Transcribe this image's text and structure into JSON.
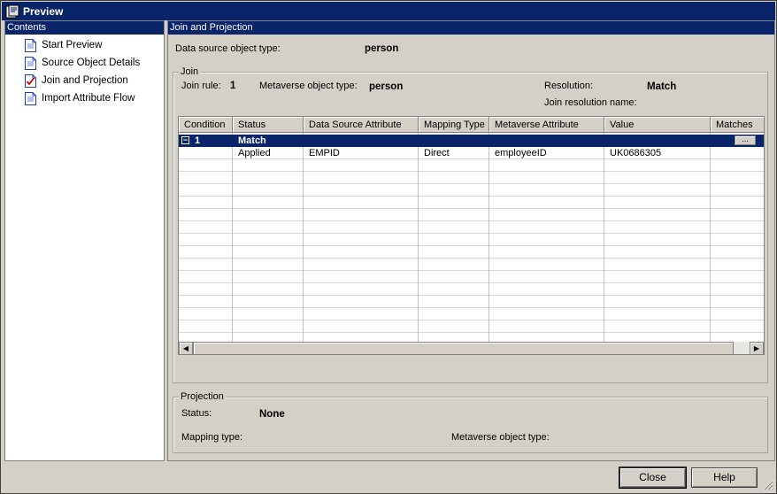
{
  "window": {
    "title": "Preview"
  },
  "contents": {
    "header": "Contents",
    "items": [
      {
        "label": "Start Preview",
        "checked": false
      },
      {
        "label": "Source Object Details",
        "checked": false
      },
      {
        "label": "Join and Projection",
        "checked": true
      },
      {
        "label": "Import Attribute Flow",
        "checked": false
      }
    ]
  },
  "main": {
    "header": "Join and Projection",
    "ds_type_label": "Data source object type:",
    "ds_type_value": "person"
  },
  "join": {
    "group_title": "Join",
    "rule_label": "Join rule:",
    "rule_value": "1",
    "mv_type_label": "Metaverse object type:",
    "mv_type_value": "person",
    "resolution_label": "Resolution:",
    "resolution_value": "Match",
    "resolution_name_label": "Join resolution name:",
    "resolution_name_value": "",
    "columns": [
      "Condition",
      "Status",
      "Data Source Attribute",
      "Mapping Type",
      "Metaverse Attribute",
      "Value",
      "Matches"
    ],
    "rows": [
      {
        "condition": "1",
        "status": "Match",
        "ds_attr": "",
        "mapping": "",
        "mv_attr": "",
        "value": "",
        "matches": "...",
        "selected": true
      },
      {
        "condition": "",
        "status": "Applied",
        "ds_attr": "EMPID",
        "mapping": "Direct",
        "mv_attr": "employeeID",
        "value": "UK0686305",
        "matches": ""
      }
    ]
  },
  "projection": {
    "group_title": "Projection",
    "status_label": "Status:",
    "status_value": "None",
    "mapping_type_label": "Mapping type:",
    "mapping_type_value": "",
    "mv_type_label": "Metaverse object type:",
    "mv_type_value": ""
  },
  "buttons": {
    "close": "Close",
    "help": "Help"
  },
  "colors": {
    "titlebar": "#0a246a",
    "face": "#d4d0c8",
    "selection": "#0a246a"
  }
}
